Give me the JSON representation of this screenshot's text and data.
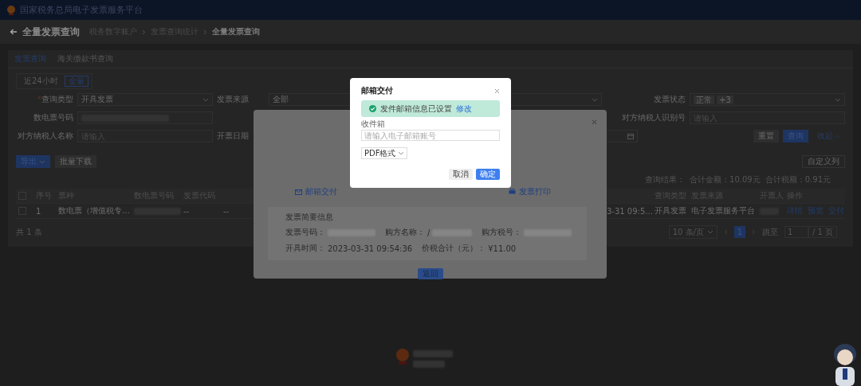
{
  "header": {
    "title": "国家税务总局电子发票服务平台"
  },
  "page": {
    "title": "全量发票查询",
    "breadcrumbs": [
      {
        "label": "税务数字账户",
        "current": false
      },
      {
        "label": "发票查询统计",
        "current": false
      },
      {
        "label": "全量发票查询",
        "current": true
      }
    ]
  },
  "tabs": [
    {
      "label": "发票查询",
      "selected": true
    },
    {
      "label": "海关缴款书查询",
      "selected": false
    }
  ],
  "time_range": [
    {
      "label": "近24小时",
      "selected": false
    },
    {
      "label": "全量",
      "selected": true
    }
  ],
  "filters": {
    "rows": [
      {
        "left": {
          "label": "查询类型",
          "required_mark": "*",
          "kind": "select",
          "value": "开具发票"
        },
        "middle": {
          "label": "发票来源",
          "kind": "select",
          "value": "全部"
        },
        "right": {
          "label": "发票状态",
          "kind": "tags",
          "tags": [
            "正常",
            "+3"
          ]
        }
      },
      {
        "left": {
          "label": "数电票号码",
          "kind": "redacted"
        },
        "right": {
          "label": "对方纳税人识别号",
          "kind": "input",
          "placeholder": "请输入"
        }
      },
      {
        "left": {
          "label": "对方纳税人名称",
          "kind": "input",
          "placeholder": "请输入"
        },
        "middle": {
          "label": "开票日期",
          "kind": "date"
        }
      }
    ],
    "actions": [
      {
        "label": "重置",
        "kind": "default"
      },
      {
        "label": "查询",
        "kind": "primary"
      },
      {
        "label": "收起",
        "kind": "link"
      }
    ]
  },
  "toolbar": {
    "buttons": [
      {
        "label": "导出",
        "kind": "primary"
      },
      {
        "label": "批量下载",
        "kind": "default"
      }
    ],
    "right_button": "自定义列"
  },
  "summary": {
    "label": "查询结果：",
    "items": [
      "合计金额：10.09元",
      "合计税额：0.91元"
    ]
  },
  "table": {
    "all_checked": false,
    "left_columns": [
      "序号",
      "票种",
      "数电票号码",
      "发票代码"
    ],
    "right_columns": [
      "查询类型",
      "发票来源",
      "开票人",
      "操作"
    ],
    "rows": [
      {
        "checked": false,
        "left_cells": [
          {
            "kind": "text",
            "text": "1"
          },
          {
            "kind": "text",
            "text": "数电票（增值税专…"
          },
          {
            "kind": "redacted"
          },
          {
            "kind": "text",
            "text": "--"
          },
          {
            "kind": "text",
            "text": "--"
          }
        ],
        "right_cells": [
          {
            "kind": "text",
            "text": "3-31 09:5…"
          },
          {
            "kind": "text",
            "text": "开具发票"
          },
          {
            "kind": "text",
            "text": "电子发票服务平台"
          },
          {
            "kind": "redacted"
          },
          {
            "kind": "links",
            "links": [
              "详情",
              "预览",
              "交付"
            ]
          }
        ]
      }
    ]
  },
  "pagination": {
    "total": "共 1 条",
    "page_size": "10 条/页",
    "pages": [
      {
        "label": "1",
        "selected": true
      }
    ],
    "jump_label": "跳至",
    "jump_value": "1",
    "page_count": "/ 1 页"
  },
  "delivery_dialog": {
    "actions": [
      {
        "label": "邮箱交付",
        "kind": "mail"
      },
      {
        "label": "发票打印",
        "kind": "print"
      }
    ],
    "info": {
      "title": "发票简要信息",
      "fields": [
        {
          "label": "发票号码：",
          "kind": "redacted"
        },
        {
          "label": "购方名称：",
          "kind": "partial",
          "value": "/"
        },
        {
          "label": "购方税号：",
          "kind": "redacted"
        },
        {
          "label": "开具时间：",
          "kind": "text",
          "value": "2023-03-31 09:54:36"
        },
        {
          "label": "价税合计（元）：",
          "kind": "text",
          "value": "¥11.00"
        }
      ]
    },
    "back_button": "返回"
  },
  "email_dialog": {
    "title": "邮箱交付",
    "notice": "发件邮箱信息已设置",
    "notice_link": "修改",
    "field_label": "收件箱",
    "placeholder": "请输入电子邮箱账号",
    "format": "PDF格式",
    "buttons": [
      {
        "label": "取消",
        "kind": "default"
      },
      {
        "label": "确定",
        "kind": "primary"
      }
    ]
  }
}
